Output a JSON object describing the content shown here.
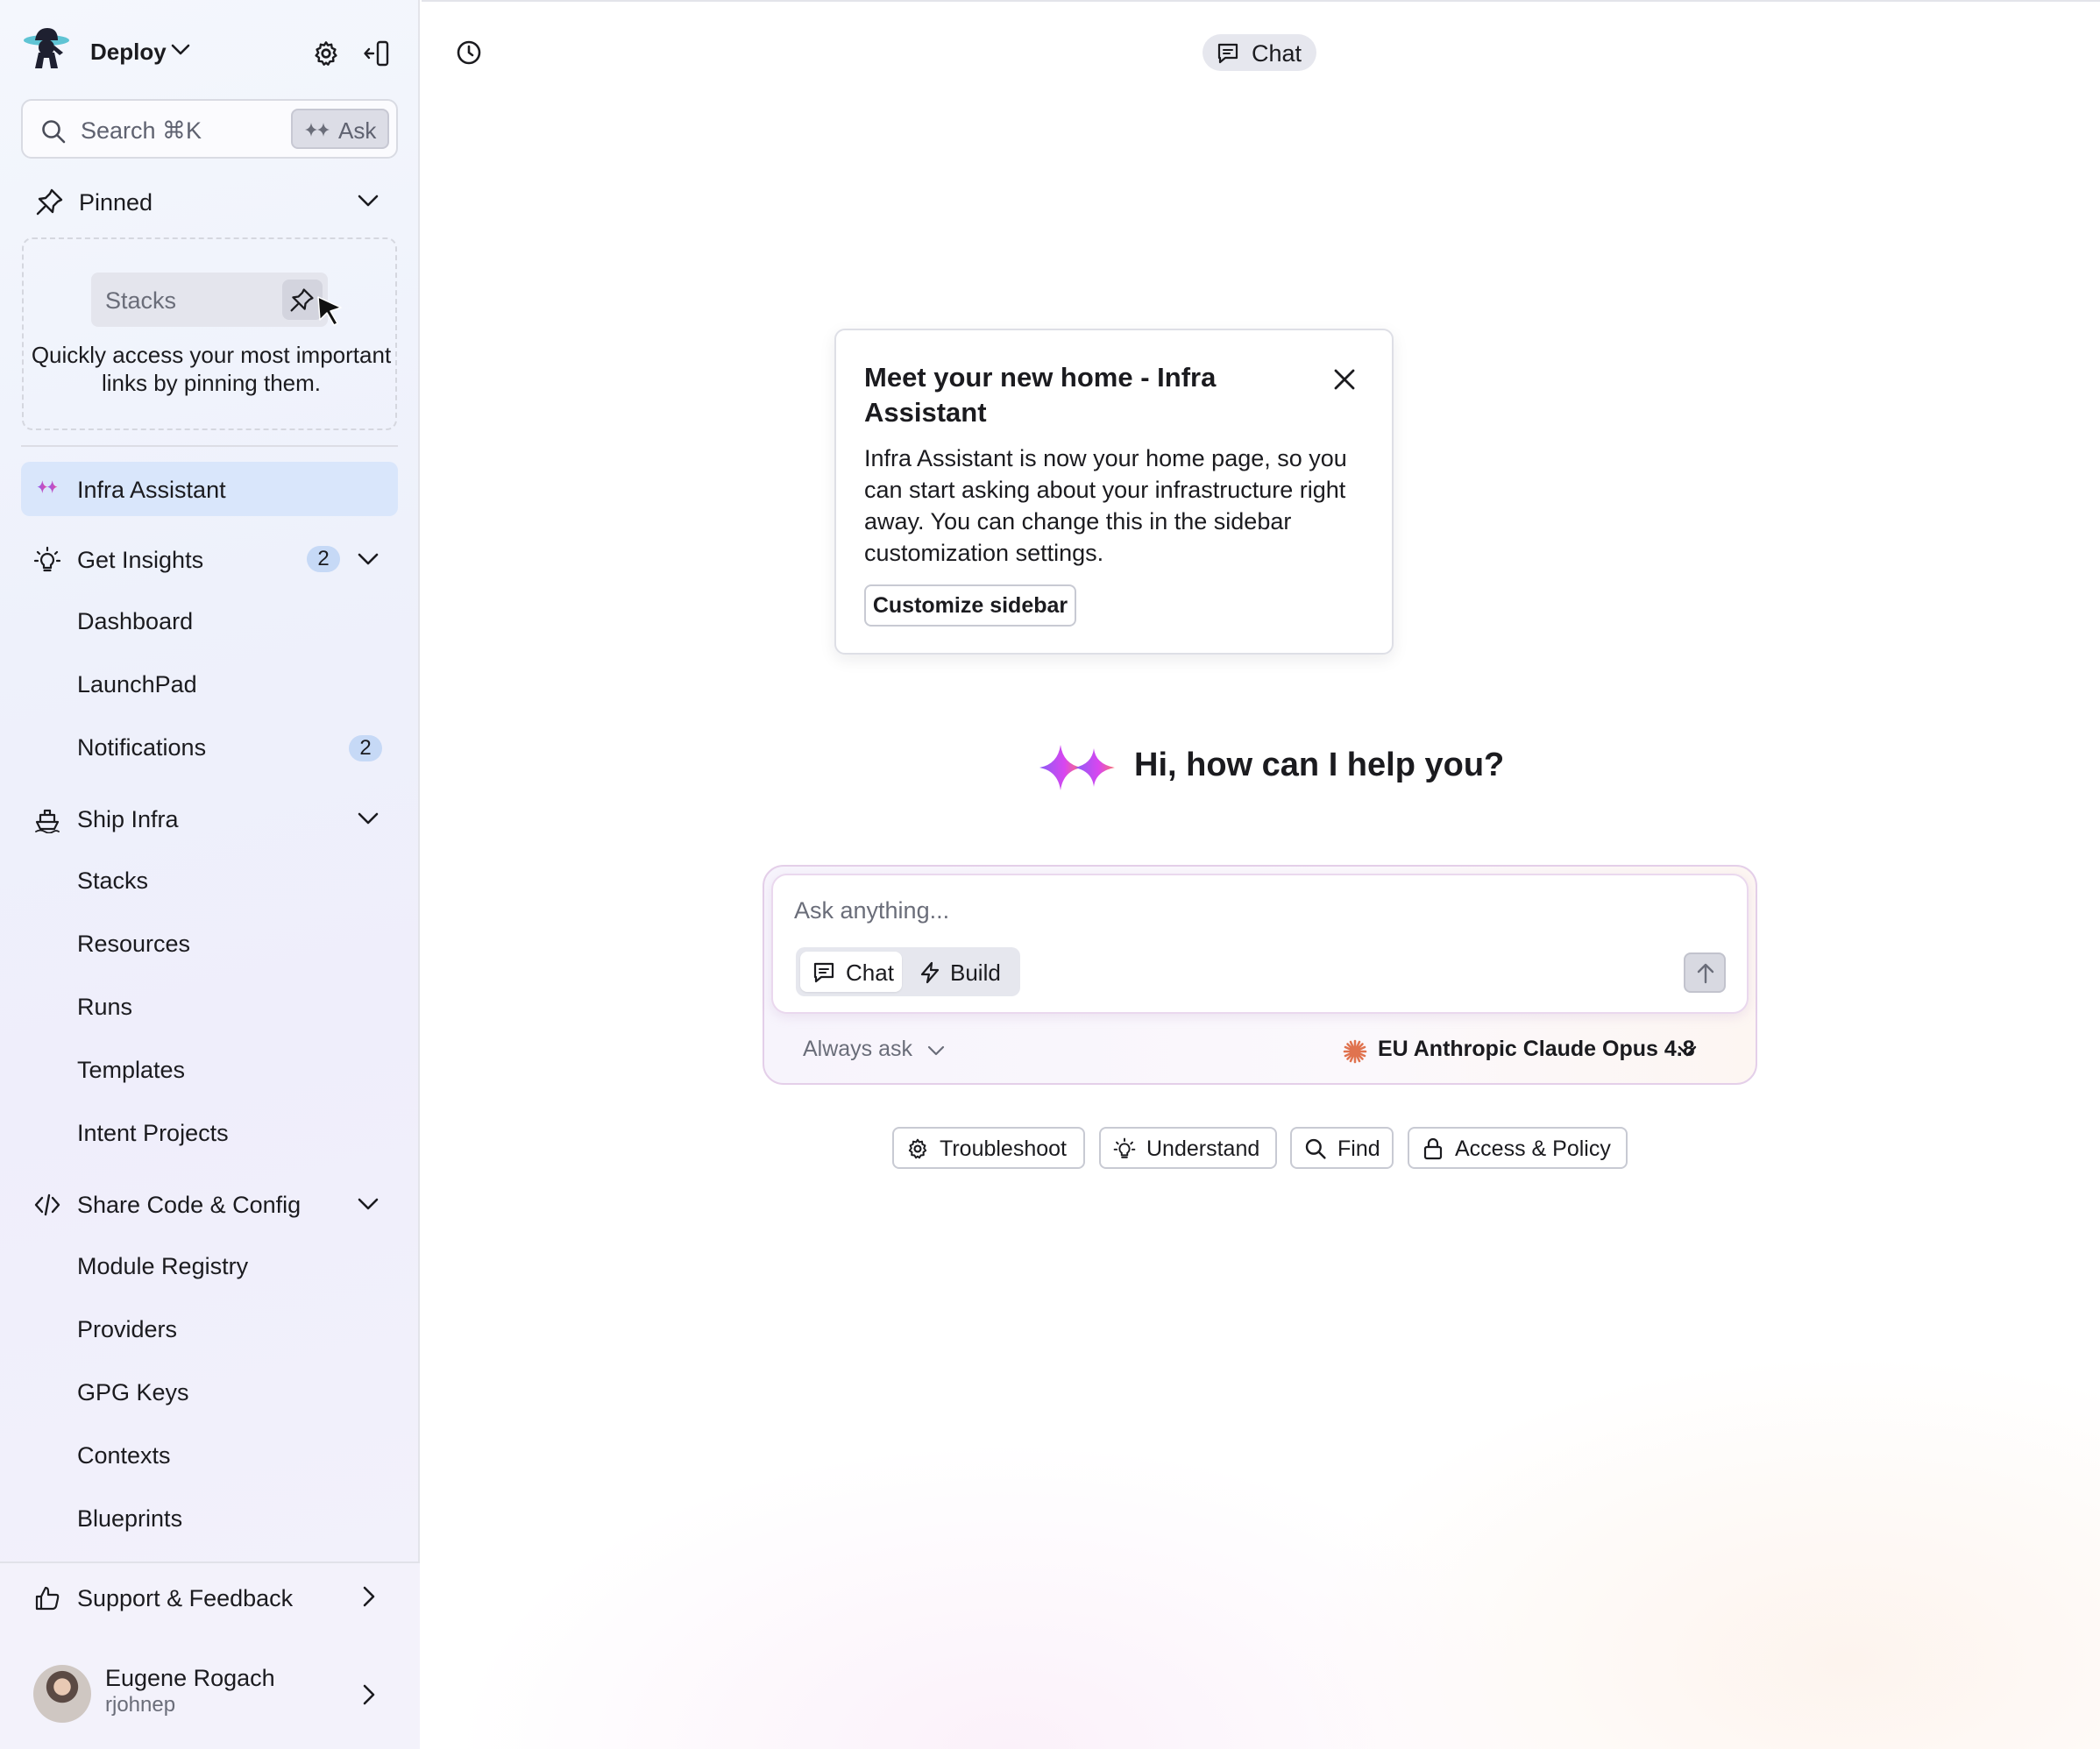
{
  "workspace": {
    "name": "Deploy"
  },
  "search": {
    "placeholder": "Search ⌘K",
    "ask_label": "Ask"
  },
  "pinned": {
    "label": "Pinned",
    "example_chip": "Stacks",
    "help_text": "Quickly access your most important links by pinning them."
  },
  "nav": {
    "infra_assistant": "Infra Assistant",
    "get_insights": {
      "label": "Get Insights",
      "badge": "2",
      "items": [
        "Dashboard",
        "LaunchPad",
        "Notifications"
      ],
      "notifications_badge": "2"
    },
    "ship_infra": {
      "label": "Ship Infra",
      "items": [
        "Stacks",
        "Resources",
        "Runs",
        "Templates",
        "Intent Projects"
      ]
    },
    "share_code": {
      "label": "Share Code & Config",
      "items": [
        "Module Registry",
        "Providers",
        "GPG Keys",
        "Contexts",
        "Blueprints"
      ]
    },
    "support": "Support & Feedback"
  },
  "user": {
    "name": "Eugene Rogach",
    "handle": "rjohnep"
  },
  "header": {
    "chat_label": "Chat"
  },
  "popover": {
    "title": "Meet your new home - Infra Assistant",
    "body": "Infra Assistant is now your home page, so you can start asking about your infrastructure right away. You can change this in the sidebar customization settings.",
    "button": "Customize sidebar"
  },
  "greeting": "Hi, how can I help you?",
  "composer": {
    "placeholder": "Ask anything...",
    "mode_chat": "Chat",
    "mode_build": "Build",
    "permission": "Always ask",
    "model": "EU Anthropic Claude Opus 4.8"
  },
  "suggestions": [
    "Troubleshoot",
    "Understand",
    "Find",
    "Access & Policy"
  ],
  "colors": {
    "accent_purple": "#8b5cf6",
    "accent_pink": "#ec4899",
    "active_nav_bg": "#d9e6fb",
    "badge_bg": "#c6d9f6"
  }
}
